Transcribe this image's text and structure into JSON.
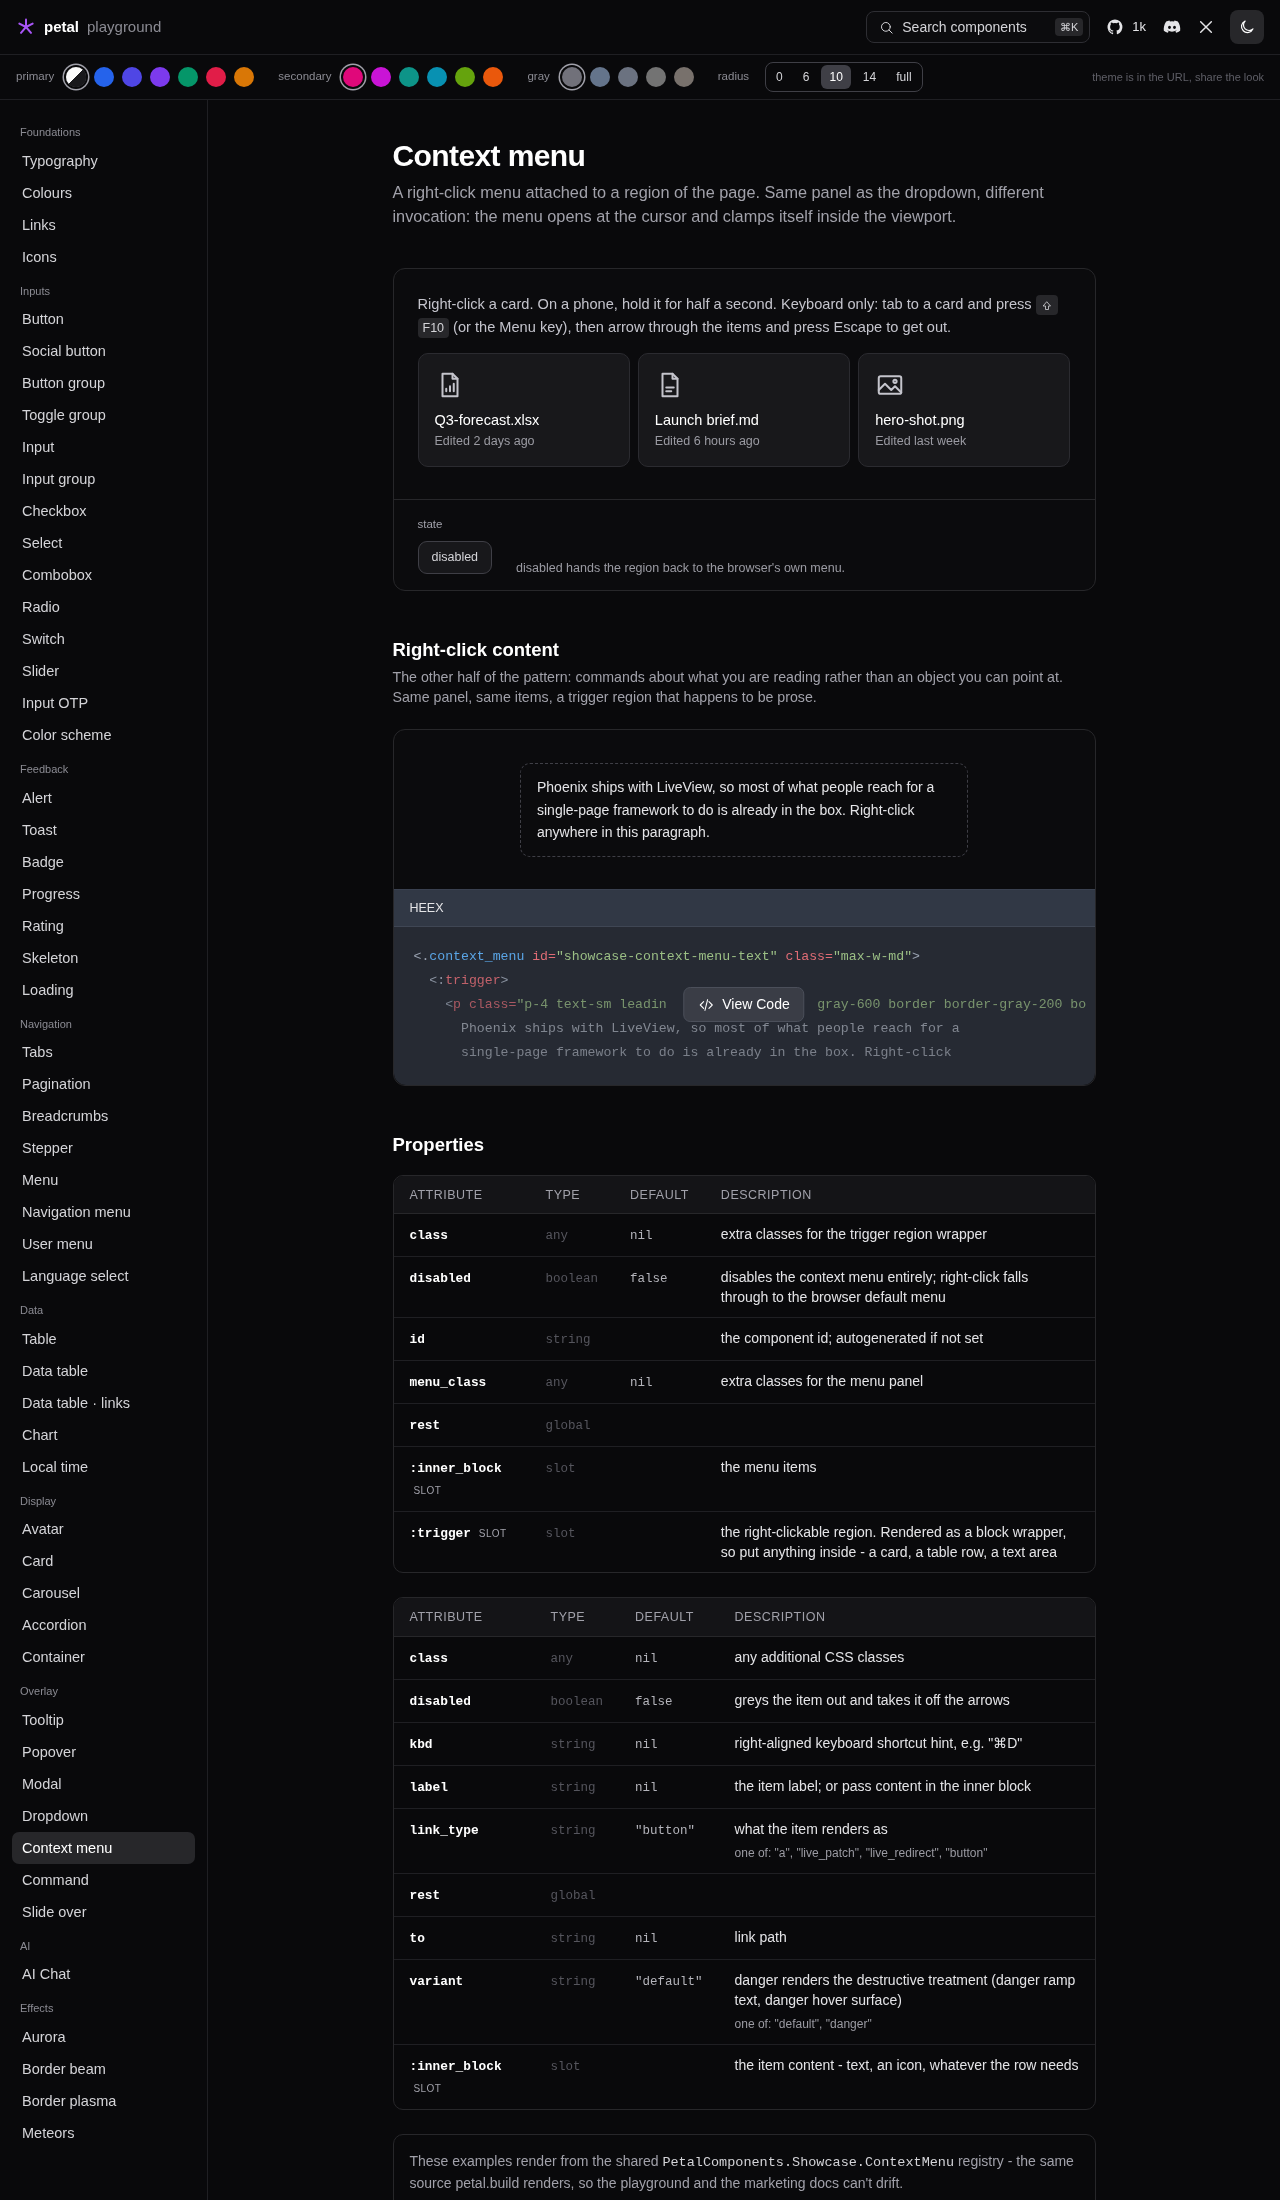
{
  "header": {
    "brand": "petal",
    "subtitle": "playground",
    "search": {
      "placeholder": "Search components",
      "shortcut": "⌘K"
    },
    "github_count": "1k"
  },
  "theme_bar": {
    "groups": [
      {
        "label": "primary",
        "swatches": [
          {
            "kind": "split",
            "selected": true
          },
          {
            "kind": "solid",
            "color": "#2563eb",
            "selected": false
          },
          {
            "kind": "solid",
            "color": "#4f46e5",
            "selected": false
          },
          {
            "kind": "solid",
            "color": "#7c3aed",
            "selected": false
          },
          {
            "kind": "solid",
            "color": "#059669",
            "selected": false
          },
          {
            "kind": "solid",
            "color": "#e11d48",
            "selected": false
          },
          {
            "kind": "solid",
            "color": "#d97706",
            "selected": false
          }
        ]
      },
      {
        "label": "secondary",
        "swatches": [
          {
            "kind": "solid",
            "color": "#e0087a",
            "selected": true
          },
          {
            "kind": "solid",
            "color": "#c914d6",
            "selected": false
          },
          {
            "kind": "solid",
            "color": "#0d9488",
            "selected": false
          },
          {
            "kind": "solid",
            "color": "#0891b2",
            "selected": false
          },
          {
            "kind": "solid",
            "color": "#65a30d",
            "selected": false
          },
          {
            "kind": "solid",
            "color": "#ea580c",
            "selected": false
          }
        ]
      },
      {
        "label": "gray",
        "swatches": [
          {
            "kind": "solid",
            "color": "#71717a",
            "selected": true
          },
          {
            "kind": "solid",
            "color": "#64748b",
            "selected": false
          },
          {
            "kind": "solid",
            "color": "#6b7280",
            "selected": false
          },
          {
            "kind": "solid",
            "color": "#737373",
            "selected": false
          },
          {
            "kind": "solid",
            "color": "#78716c",
            "selected": false
          }
        ]
      }
    ],
    "radius": {
      "label": "radius",
      "options": [
        {
          "label": "0",
          "selected": false
        },
        {
          "label": "6",
          "selected": false
        },
        {
          "label": "10",
          "selected": true
        },
        {
          "label": "14",
          "selected": false
        },
        {
          "label": "full",
          "selected": false
        }
      ]
    },
    "note": "theme is in the URL, share the look"
  },
  "sidebar": {
    "sections": [
      {
        "heading": "Foundations",
        "items": [
          {
            "label": "Typography",
            "selected": false
          },
          {
            "label": "Colours",
            "selected": false
          },
          {
            "label": "Links",
            "selected": false
          },
          {
            "label": "Icons",
            "selected": false
          }
        ]
      },
      {
        "heading": "Inputs",
        "items": [
          {
            "label": "Button",
            "selected": false
          },
          {
            "label": "Social button",
            "selected": false
          },
          {
            "label": "Button group",
            "selected": false
          },
          {
            "label": "Toggle group",
            "selected": false
          },
          {
            "label": "Input",
            "selected": false
          },
          {
            "label": "Input group",
            "selected": false
          },
          {
            "label": "Checkbox",
            "selected": false
          },
          {
            "label": "Select",
            "selected": false
          },
          {
            "label": "Combobox",
            "selected": false
          },
          {
            "label": "Radio",
            "selected": false
          },
          {
            "label": "Switch",
            "selected": false
          },
          {
            "label": "Slider",
            "selected": false
          },
          {
            "label": "Input OTP",
            "selected": false
          },
          {
            "label": "Color scheme",
            "selected": false
          }
        ]
      },
      {
        "heading": "Feedback",
        "items": [
          {
            "label": "Alert",
            "selected": false
          },
          {
            "label": "Toast",
            "selected": false
          },
          {
            "label": "Badge",
            "selected": false
          },
          {
            "label": "Progress",
            "selected": false
          },
          {
            "label": "Rating",
            "selected": false
          },
          {
            "label": "Skeleton",
            "selected": false
          },
          {
            "label": "Loading",
            "selected": false
          }
        ]
      },
      {
        "heading": "Navigation",
        "items": [
          {
            "label": "Tabs",
            "selected": false
          },
          {
            "label": "Pagination",
            "selected": false
          },
          {
            "label": "Breadcrumbs",
            "selected": false
          },
          {
            "label": "Stepper",
            "selected": false
          },
          {
            "label": "Menu",
            "selected": false
          },
          {
            "label": "Navigation menu",
            "selected": false
          },
          {
            "label": "User menu",
            "selected": false
          },
          {
            "label": "Language select",
            "selected": false
          }
        ]
      },
      {
        "heading": "Data",
        "items": [
          {
            "label": "Table",
            "selected": false
          },
          {
            "label": "Data table",
            "selected": false
          },
          {
            "label": "Data table · links",
            "selected": false
          },
          {
            "label": "Chart",
            "selected": false
          },
          {
            "label": "Local time",
            "selected": false
          }
        ]
      },
      {
        "heading": "Display",
        "items": [
          {
            "label": "Avatar",
            "selected": false
          },
          {
            "label": "Card",
            "selected": false
          },
          {
            "label": "Carousel",
            "selected": false
          },
          {
            "label": "Accordion",
            "selected": false
          },
          {
            "label": "Container",
            "selected": false
          }
        ]
      },
      {
        "heading": "Overlay",
        "items": [
          {
            "label": "Tooltip",
            "selected": false
          },
          {
            "label": "Popover",
            "selected": false
          },
          {
            "label": "Modal",
            "selected": false
          },
          {
            "label": "Dropdown",
            "selected": false
          },
          {
            "label": "Context menu",
            "selected": true
          },
          {
            "label": "Command",
            "selected": false
          },
          {
            "label": "Slide over",
            "selected": false
          }
        ]
      },
      {
        "heading": "AI",
        "items": [
          {
            "label": "AI Chat",
            "selected": false
          }
        ]
      },
      {
        "heading": "Effects",
        "items": [
          {
            "label": "Aurora",
            "selected": false
          },
          {
            "label": "Border beam",
            "selected": false
          },
          {
            "label": "Border plasma",
            "selected": false
          },
          {
            "label": "Meteors",
            "selected": false
          }
        ]
      }
    ]
  },
  "page": {
    "title": "Context menu",
    "intro": "A right-click menu attached to a region of the page. Same panel as the dropdown, different invocation: the menu opens at the cursor and clamps itself inside the viewport.",
    "demo": {
      "instructions_before": "Right-click a card. On a phone, hold it for half a second. Keyboard only: tab to a card and press",
      "key": "F10",
      "instructions_after": "(or the Menu key), then arrow through the items and press Escape to get out.",
      "cards": [
        {
          "kind": "spreadsheet",
          "name": "Q3-forecast.xlsx",
          "meta": "Edited 2 days ago"
        },
        {
          "kind": "document",
          "name": "Launch brief.md",
          "meta": "Edited 6 hours ago"
        },
        {
          "kind": "image",
          "name": "hero-shot.png",
          "meta": "Edited last week"
        }
      ],
      "state_label": "state",
      "toggles": [
        {
          "label": "disabled",
          "on": false
        }
      ],
      "state_note": "disabled hands the region back to the browser's own menu."
    },
    "section": {
      "title": "Right-click content",
      "text": "The other half of the pattern: commands about what you are reading rather than an object you can point at. Same panel, same items, a trigger region that happens to be prose.",
      "prose": "Phoenix ships with LiveView, so most of what people reach for a single-page framework to do is already in the box. Right-click anywhere in this paragraph.",
      "code": {
        "language": "HEEX",
        "button": "View Code",
        "lines": [
          [
            {
              "kind": "punct",
              "text": "<."
            },
            {
              "kind": "tag",
              "text": "context_menu"
            },
            {
              "kind": "attr",
              "text": " id="
            },
            {
              "kind": "string",
              "text": "\"showcase-context-menu-text\""
            },
            {
              "kind": "attr",
              "text": " class="
            },
            {
              "kind": "string",
              "text": "\"max-w-md\""
            },
            {
              "kind": "punct",
              "text": ">"
            }
          ],
          [
            {
              "kind": "punct",
              "text": "  <:"
            },
            {
              "kind": "attr",
              "text": "trigger"
            },
            {
              "kind": "punct",
              "text": ">"
            }
          ],
          [
            {
              "kind": "punct",
              "text": "    <"
            },
            {
              "kind": "attr",
              "text": "p class="
            },
            {
              "kind": "string",
              "text": "\"p-4 text-sm leadin"
            },
            {
              "kind": "gap"
            },
            {
              "kind": "string",
              "text": "gray-600 border border-gray-200 bo"
            }
          ],
          [
            {
              "kind": "text",
              "text": "      Phoenix ships with LiveView, so most of what people reach for a"
            }
          ],
          [
            {
              "kind": "text",
              "text": "      single-page framework to do is already in the box. Right-click"
            }
          ]
        ]
      }
    },
    "properties": {
      "title": "Properties",
      "tables": [
        {
          "columns": [
            "ATTRIBUTE",
            "TYPE",
            "DEFAULT",
            "DESCRIPTION"
          ],
          "rows": [
            {
              "attribute": "class",
              "type": "any",
              "default": "nil",
              "description": "extra classes for the trigger region wrapper"
            },
            {
              "attribute": "disabled",
              "type": "boolean",
              "default": "false",
              "description": "disables the context menu entirely; right-click falls through to the browser default menu"
            },
            {
              "attribute": "id",
              "type": "string",
              "description": "the component id; autogenerated if not set"
            },
            {
              "attribute": "menu_class",
              "type": "any",
              "default": "nil",
              "description": "extra classes for the menu panel"
            },
            {
              "attribute": "rest",
              "type": "global"
            },
            {
              "attribute": ":inner_block",
              "tag": "SLOT",
              "type": "slot",
              "description": "the menu items"
            },
            {
              "attribute": ":trigger",
              "tag": "SLOT",
              "type": "slot",
              "description": "the right-clickable region. Rendered as a block wrapper, so put anything inside - a card, a table row, a text area"
            }
          ]
        },
        {
          "columns": [
            "ATTRIBUTE",
            "TYPE",
            "DEFAULT",
            "DESCRIPTION"
          ],
          "rows": [
            {
              "attribute": "class",
              "type": "any",
              "default": "nil",
              "description": "any additional CSS classes"
            },
            {
              "attribute": "disabled",
              "type": "boolean",
              "default": "false",
              "description": "greys the item out and takes it off the arrows"
            },
            {
              "attribute": "kbd",
              "type": "string",
              "default": "nil",
              "description": "right-aligned keyboard shortcut hint, e.g. \"⌘D\""
            },
            {
              "attribute": "label",
              "type": "string",
              "default": "nil",
              "description": "the item label; or pass content in the inner block"
            },
            {
              "attribute": "link_type",
              "type": "string",
              "default": "\"button\"",
              "description": "what the item renders as",
              "options": "one of: \"a\", \"live_patch\", \"live_redirect\", \"button\""
            },
            {
              "attribute": "rest",
              "type": "global"
            },
            {
              "attribute": "to",
              "type": "string",
              "default": "nil",
              "description": "link path"
            },
            {
              "attribute": "variant",
              "type": "string",
              "default": "\"default\"",
              "description": "danger renders the destructive treatment (danger ramp text, danger hover surface)",
              "options": "one of: \"default\", \"danger\""
            },
            {
              "attribute": ":inner_block",
              "tag": "SLOT",
              "type": "slot",
              "description": "the item content - text, an icon, whatever the row needs"
            }
          ]
        }
      ]
    },
    "footer_note": {
      "before": "These examples render from the shared ",
      "code": "PetalComponents.Showcase.ContextMenu",
      "after": " registry - the same source petal.build renders, so the playground and the marketing docs can't drift."
    }
  }
}
